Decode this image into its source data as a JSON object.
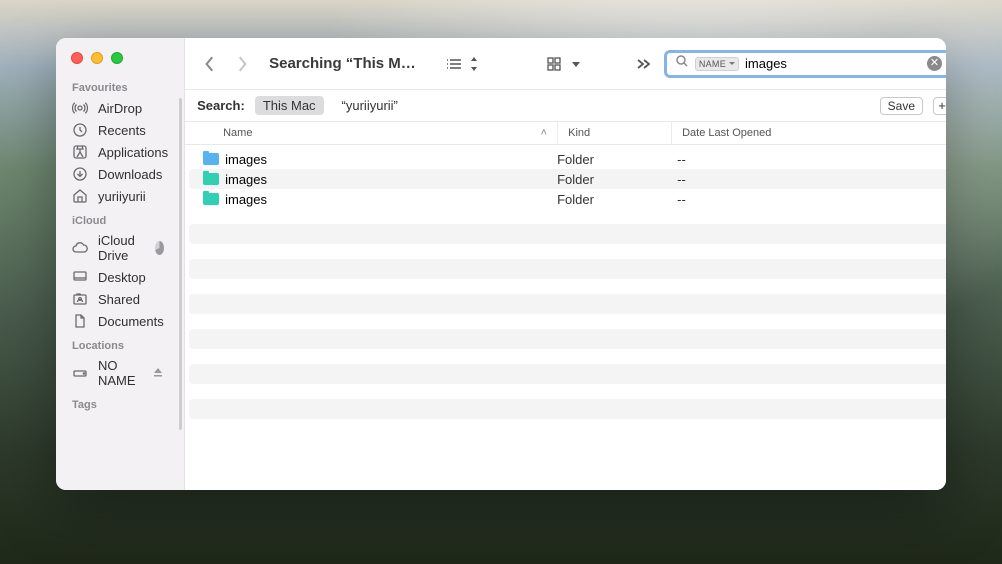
{
  "sidebar": {
    "sections": {
      "favourites": {
        "title": "Favourites",
        "items": [
          "AirDrop",
          "Recents",
          "Applications",
          "Downloads",
          "yuriiyurii"
        ]
      },
      "icloud": {
        "title": "iCloud",
        "items": [
          "iCloud Drive",
          "Desktop",
          "Shared",
          "Documents"
        ]
      },
      "locations": {
        "title": "Locations",
        "items": [
          "NO NAME"
        ]
      },
      "tags": {
        "title": "Tags"
      }
    }
  },
  "toolbar": {
    "title": "Searching “This M…",
    "search_token": "NAME",
    "search_value": "images"
  },
  "scope": {
    "label": "Search:",
    "scope_thismac": "This Mac",
    "scope_user": "“yuriiyurii”",
    "save_label": "Save"
  },
  "columns": {
    "name": "Name",
    "kind": "Kind",
    "date": "Date Last Opened"
  },
  "rows": [
    {
      "name": "images",
      "kind": "Folder",
      "date": "--",
      "color": "#56b3f0"
    },
    {
      "name": "images",
      "kind": "Folder",
      "date": "--",
      "color": "#2fd1b2"
    },
    {
      "name": "images",
      "kind": "Folder",
      "date": "--",
      "color": "#2fd1b2"
    }
  ]
}
